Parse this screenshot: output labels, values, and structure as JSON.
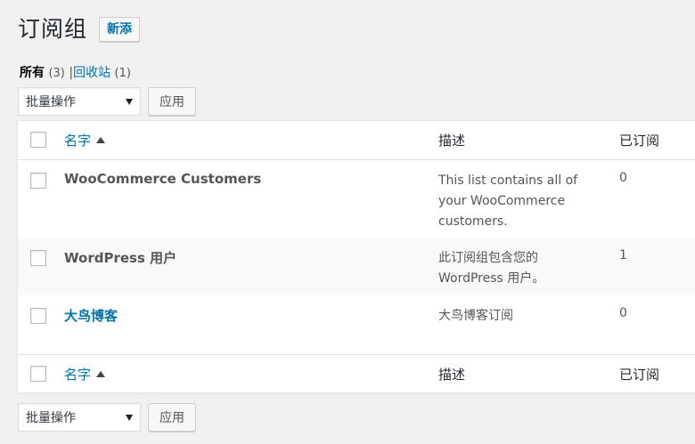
{
  "header": {
    "title": "订阅组",
    "add_new": "新添"
  },
  "filters": {
    "all_label": "所有",
    "all_count": "(3)",
    "separator": "|",
    "trash_label": "回收站",
    "trash_count": "(1)"
  },
  "bulk": {
    "select_value": "批量操作",
    "apply": "应用"
  },
  "table": {
    "columns": {
      "name": "名字",
      "description": "描述",
      "subscribed": "已订阅"
    },
    "rows": [
      {
        "name": "WooCommerce Customers",
        "description": "This list contains all of your WooCommerce customers.",
        "subscribed": "0"
      },
      {
        "name": "WordPress 用户",
        "description": "此订阅组包含您的 WordPress 用户。",
        "subscribed": "1"
      },
      {
        "name": "大鸟博客",
        "description": "大鸟博客订阅",
        "subscribed": "0"
      }
    ]
  },
  "colors": {
    "link": "#0073aa",
    "text": "#23282d",
    "background": "#f1f1f1"
  }
}
